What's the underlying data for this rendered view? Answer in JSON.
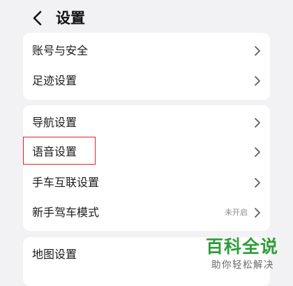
{
  "header": {
    "title": "设置",
    "back_icon": "chevron-left-icon"
  },
  "groups": [
    {
      "items": [
        {
          "label": "账号与安全"
        },
        {
          "label": "足迹设置"
        }
      ]
    },
    {
      "items": [
        {
          "label": "导航设置"
        },
        {
          "label": "语音设置"
        },
        {
          "label": "手车互联设置"
        },
        {
          "label": "新手驾车模式",
          "status": "未开启"
        }
      ]
    },
    {
      "items": [
        {
          "label": "地图设置"
        }
      ]
    }
  ],
  "watermark": {
    "main": "百科全说",
    "sub": "助你轻松解决"
  },
  "colors": {
    "background": "#f2f2f4",
    "card": "#ffffff",
    "highlight": "#e0262d",
    "watermark_green": "#2f9c3b"
  }
}
